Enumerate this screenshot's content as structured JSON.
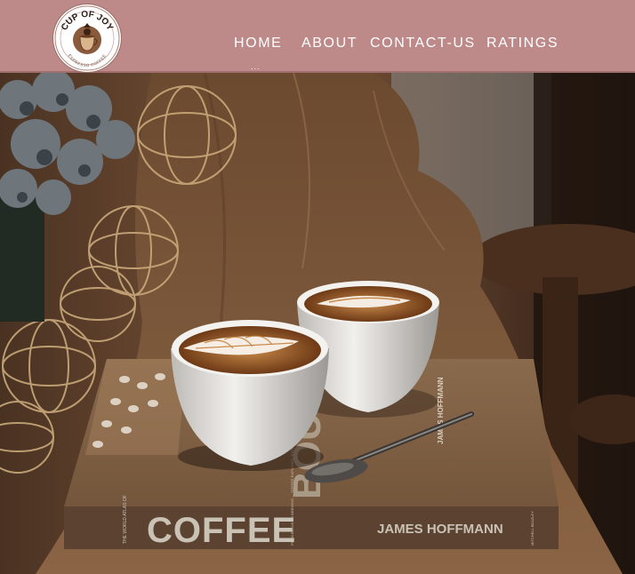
{
  "nav": {
    "logo_text": "CUP OF JOY",
    "logo_subtext": "ESPRESSO COFFEE",
    "links": [
      {
        "label": "HOME"
      },
      {
        "label": "ABOUT"
      },
      {
        "label": "CONTACT-US"
      },
      {
        "label": "RATINGS"
      }
    ],
    "active_indicator": "..."
  },
  "hero": {
    "book_title": "COFFEE",
    "book_author": "JAMES HOFFMANN",
    "book_spine_left": "THE WORLD ATLAS OF",
    "book_spine_mid": "FROM BEANS TO BREWING — COFFEE EXPLORED, EXPLAINED AND ENJOYED",
    "book_spine_right": "MITCHELL BEAZLEY",
    "book_cover_partial": "BOUT",
    "book_cover_side": "JAMES HOFFMANN"
  },
  "colors": {
    "nav_bg": "#bd8a89",
    "nav_text": "#ffffff"
  }
}
